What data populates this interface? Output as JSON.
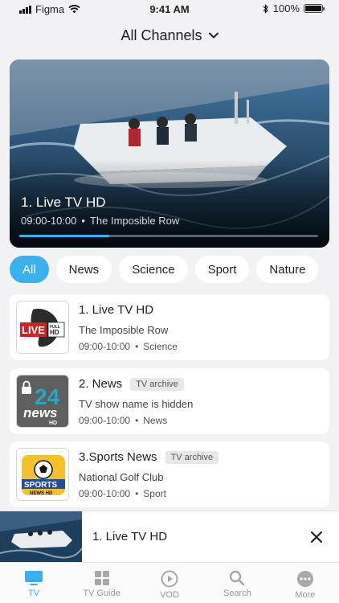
{
  "status": {
    "carrier": "Figma",
    "time": "9:41 AM",
    "battery": "100%"
  },
  "header": {
    "title": "All Channels"
  },
  "hero": {
    "title": "1. Live TV HD",
    "time": "09:00-10:00",
    "program": "The Imposible Row",
    "progress": 0.3
  },
  "filters": [
    "All",
    "News",
    "Science",
    "Sport",
    "Nature"
  ],
  "channels": [
    {
      "title": "1. Live TV HD",
      "badge": "",
      "program": "The Imposible Row",
      "time": "09:00-10:00",
      "category": "Science"
    },
    {
      "title": "2. News",
      "badge": "TV archive",
      "program": "TV show name is hidden",
      "time": "09:00-10:00",
      "category": "News"
    },
    {
      "title": "3.Sports News",
      "badge": "TV archive",
      "program": "National Golf Club",
      "time": "09:00-10:00",
      "category": "Sport"
    }
  ],
  "logos": {
    "live_text": "LIVE",
    "full_hd": "FULL HD",
    "news_text": "news",
    "hd_text": "HD",
    "sports_text": "SPORTS",
    "sports_news": "NEWS HD"
  },
  "mini_player": {
    "title": "1. Live TV HD"
  },
  "tabs": [
    {
      "label": "TV",
      "icon": "tv-icon"
    },
    {
      "label": "TV Guide",
      "icon": "grid-icon"
    },
    {
      "label": "VOD",
      "icon": "play-circle-icon"
    },
    {
      "label": "Search",
      "icon": "search-icon"
    },
    {
      "label": "More",
      "icon": "more-icon"
    }
  ],
  "colors": {
    "accent": "#3ab0ef",
    "background": "#f2f2f4"
  }
}
